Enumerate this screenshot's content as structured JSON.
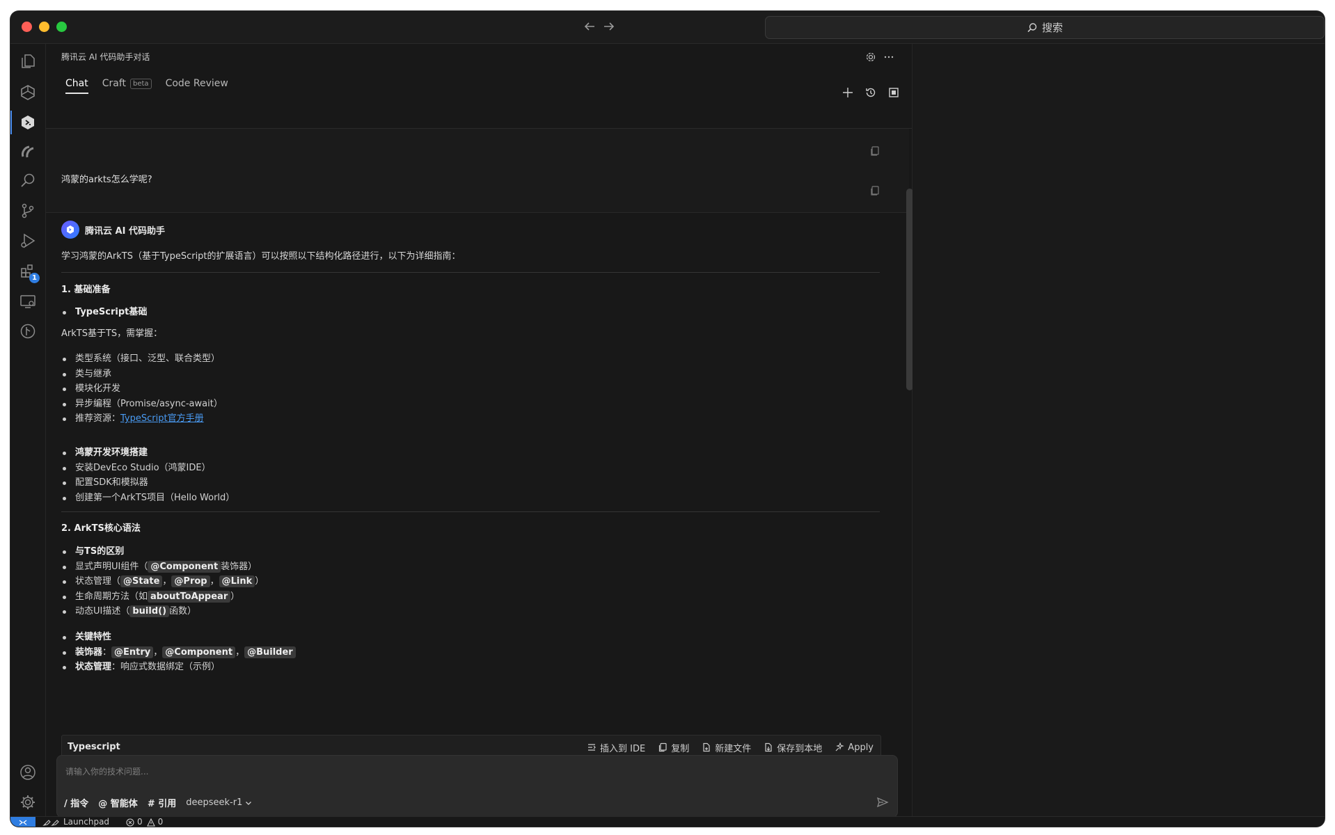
{
  "titlebar": {
    "search_label": "搜索"
  },
  "activity": {
    "icons": [
      "files-icon",
      "cube-icon",
      "codebuddy-icon",
      "ai-icon",
      "search-icon",
      "source-control-icon",
      "run-debug-icon",
      "extensions-icon",
      "remote-explorer-icon",
      "timeline-icon"
    ],
    "extensions_badge": "1"
  },
  "panel": {
    "title": "腾讯云 AI 代码助手对话",
    "tabs": [
      {
        "label": "Chat",
        "active": true
      },
      {
        "label": "Craft",
        "badge": "beta"
      },
      {
        "label": "Code Review"
      }
    ]
  },
  "question": {
    "text": "鸿蒙的arkts怎么学呢?"
  },
  "answer": {
    "assistant_name": "腾讯云 AI 代码助手",
    "intro": "学习鸿蒙的ArkTS（基于TypeScript的扩展语言）可以按照以下结构化路径进行，以下为详细指南：",
    "section1_title": "1. 基础准备",
    "s1_item1": "TypeScript基础",
    "s1_para": "ArkTS基于TS，需掌握：",
    "s1_list": [
      "类型系统（接口、泛型、联合类型）",
      "类与继承",
      "模块化开发",
      "异步编程（Promise/async-await）"
    ],
    "s1_resource_prefix": "推荐资源：",
    "s1_resource_link": "TypeScript官方手册",
    "s1_item2": "鸿蒙开发环境搭建",
    "s1_list2": [
      "安装DevEco Studio（鸿蒙IDE）",
      "配置SDK和模拟器",
      "创建第一个ArkTS项目（Hello World）"
    ],
    "section2_title": "2. ArkTS核心语法",
    "s2_item1": "与TS的区别",
    "s2_l1_prefix": "显式声明UI组件（",
    "s2_l1_code": "@Component",
    "s2_l1_suffix": "装饰器）",
    "s2_l2_prefix": "状态管理（",
    "s2_l2_code1": "@State",
    "s2_l2_code2": "@Prop",
    "s2_l2_code3": "@Link",
    "s2_l2_suffix": "）",
    "s2_l3_prefix": "生命周期方法（如",
    "s2_l3_code": "aboutToAppear",
    "s2_l3_suffix": "）",
    "s2_l4_prefix": "动态UI描述（",
    "s2_l4_code": "build()",
    "s2_l4_suffix": "函数）",
    "comma": "，",
    "s2_item2": "关键特性",
    "s2_k1_label": "装饰器",
    "s2_k1_colon": "：",
    "s2_k1_code1": "@Entry",
    "s2_k1_code2": "@Component",
    "s2_k1_code3": "@Builder",
    "s2_k2_label": "状态管理",
    "s2_k2_text": "：响应式数据绑定（示例）"
  },
  "codeblock": {
    "language": "Typescript",
    "actions": [
      "插入到 IDE",
      "复制",
      "新建文件",
      "保存到本地",
      "Apply"
    ]
  },
  "input": {
    "placeholder": "请输入你的技术问题...",
    "command": "/ 指令",
    "agent": "@ 智能体",
    "reference": "# 引用",
    "model": "deepseek-r1"
  },
  "statusbar": {
    "launchpad": "Launchpad",
    "errors": "0",
    "warnings": "0"
  }
}
